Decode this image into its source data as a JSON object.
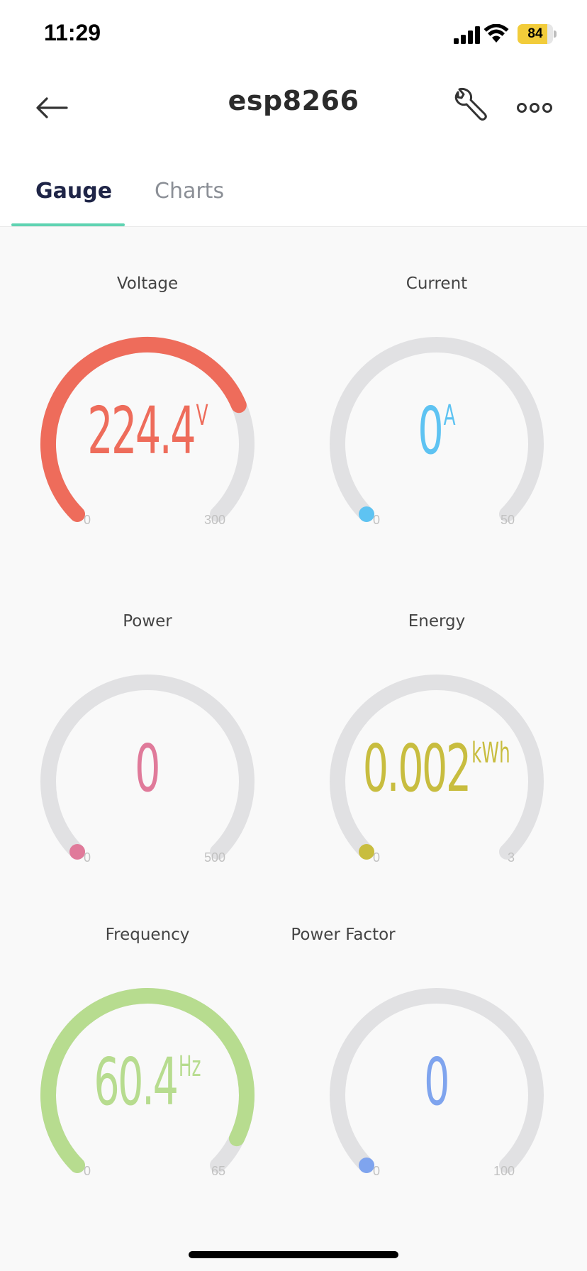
{
  "status_bar": {
    "time": "11:29",
    "battery_label": "84",
    "battery_level": 0.84,
    "icons": [
      "signal-icon",
      "wifi-icon",
      "battery-icon"
    ]
  },
  "header": {
    "title": "esp8266",
    "icons": [
      "back-arrow-icon",
      "wrench-icon",
      "more-icon"
    ]
  },
  "tabs": [
    {
      "label": "Gauge",
      "active": true
    },
    {
      "label": "Charts",
      "active": false
    }
  ],
  "colors": {
    "accent": "#5fd3b2",
    "track": "#e1e1e3",
    "voltage": "#ee6c5b",
    "current": "#5ec3f2",
    "power": "#e07a9a",
    "energy": "#c8bd3f",
    "frequency": "#b7dc8f",
    "power_factor": "#7fa4ee"
  },
  "gauges": [
    {
      "label": "Voltage",
      "value": "224.4",
      "unit": "V",
      "numeric": 224.4,
      "min": "0",
      "max": "300",
      "min_val": 0,
      "max_val": 300,
      "color": "#ee6c5b"
    },
    {
      "label": "Current",
      "value": "0",
      "unit": "A",
      "numeric": 0,
      "min": "0",
      "max": "50",
      "min_val": 0,
      "max_val": 50,
      "color": "#5ec3f2"
    },
    {
      "label": "Power",
      "value": "0",
      "unit": "",
      "numeric": 0,
      "min": "0",
      "max": "500",
      "min_val": 0,
      "max_val": 500,
      "color": "#e07a9a"
    },
    {
      "label": "Energy",
      "value": "0.002",
      "unit": "kWh",
      "numeric": 0.002,
      "min": "0",
      "max": "3",
      "min_val": 0,
      "max_val": 3,
      "color": "#c8bd3f"
    },
    {
      "label": "Frequency",
      "value": "60.4",
      "unit": "Hz",
      "numeric": 60.4,
      "min": "0",
      "max": "65",
      "min_val": 0,
      "max_val": 65,
      "color": "#b7dc8f"
    },
    {
      "label": "Power Factor",
      "value": "0",
      "unit": "",
      "numeric": 0,
      "min": "0",
      "max": "100",
      "min_val": 0,
      "max_val": 100,
      "color": "#7fa4ee"
    }
  ]
}
